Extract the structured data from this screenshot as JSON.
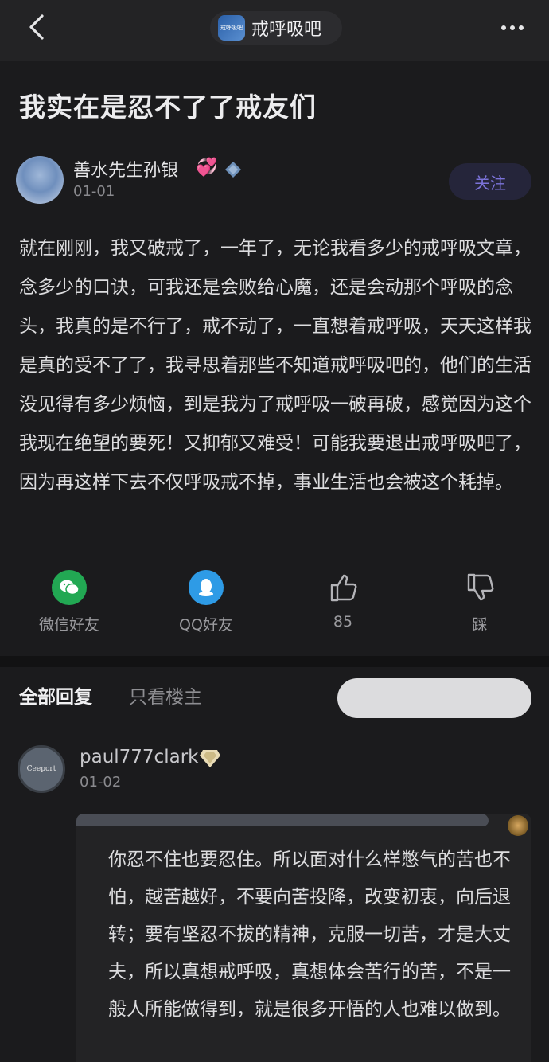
{
  "header": {
    "forum_logo_text": "戒呼吸吧",
    "forum_name": "戒呼吸吧"
  },
  "post": {
    "title": "我实在是忍不了了戒友们",
    "author": {
      "name": "善水先生孙银",
      "badge": "💞",
      "date": "01-01"
    },
    "follow_label": "关注",
    "body": "就在刚刚，我又破戒了，一年了，无论我看多少的戒呼吸文章，念多少的口诀，可我还是会败给心魔，还是会动那个呼吸的念头，我真的是不行了，戒不动了，一直想着戒呼吸，天天这样我是真的受不了了，我寻思着那些不知道戒呼吸吧的，他们的生活没见得有多少烦恼，到是我为了戒呼吸一破再破，感觉因为这个我现在绝望的要死！又抑郁又难受！可能我要退出戒呼吸吧了，因为再这样下去不仅呼吸戒不掉，事业生活也会被这个耗掉。"
  },
  "actions": {
    "wechat_label": "微信好友",
    "qq_label": "QQ好友",
    "like_count": "85",
    "dislike_label": "踩"
  },
  "tabs": {
    "all_replies": "全部回复",
    "op_only": "只看楼主"
  },
  "reply": {
    "avatar_text": "Ceeport",
    "username": "paul777clark",
    "date": "01-02",
    "text": "你忍不住也要忍住。所以面对什么样憋气的苦也不怕，越苦越好，不要向苦投降，改变初衷，向后退转；要有坚忍不拔的精神，克服一切苦，才是大丈夫，所以真想戒呼吸，真想体会苦行的苦，不是一般人所能做得到，就是很多开悟的人也难以做到。"
  },
  "colors": {
    "background": "#1b1b1d",
    "follow_text": "#7b73d9",
    "wechat_green": "#22a853",
    "qq_blue": "#2e9be6"
  }
}
